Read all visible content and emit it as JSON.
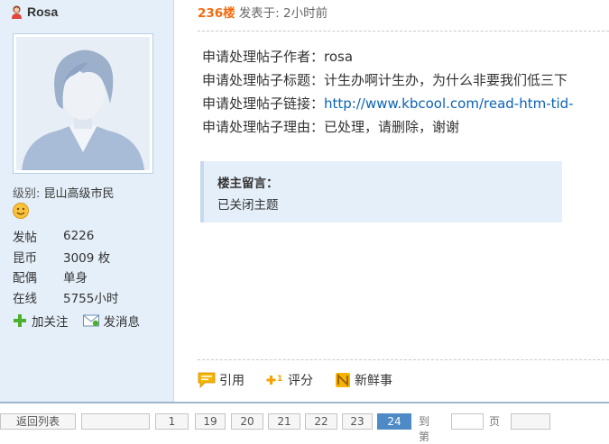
{
  "user": {
    "name": "Rosa",
    "level_label": "级别:",
    "level_value": "昆山高级市民",
    "stats": [
      {
        "key": "发帖",
        "value": "6226"
      },
      {
        "key": "昆币",
        "value": "3009 枚"
      },
      {
        "key": "配偶",
        "value": "单身"
      },
      {
        "key": "在线",
        "value": "5755小时"
      }
    ],
    "actions": {
      "follow": "加关注",
      "message": "发消息"
    }
  },
  "post": {
    "floor": "236楼",
    "posted": "发表于: 2小时前",
    "lines": [
      {
        "label": "申请处理帖子作者：",
        "value": "rosa",
        "is_link": false
      },
      {
        "label": "申请处理帖子标题：",
        "value": "计生办啊计生办，为什么非要我们低三下",
        "is_link": false
      },
      {
        "label": "申请处理帖子链接：",
        "value": "http://www.kbcool.com/read-htm-tid-",
        "is_link": true
      },
      {
        "label": "申请处理帖子理由：",
        "value": "已处理，请删除，谢谢",
        "is_link": false
      }
    ],
    "owner_note": {
      "title": "楼主留言：",
      "text": "已关闭主题"
    },
    "tools": {
      "quote": "引用",
      "rate": "评分",
      "fresh": "新鲜事"
    }
  },
  "pager": {
    "back": "返回列表",
    "pages": [
      "1",
      "19",
      "20",
      "21",
      "22",
      "23"
    ],
    "current": "24",
    "goto_label": "到第",
    "page_unit": "页"
  },
  "colors": {
    "accent": "#f26c11",
    "link": "#0a63b8",
    "panel": "#e4eff9"
  }
}
